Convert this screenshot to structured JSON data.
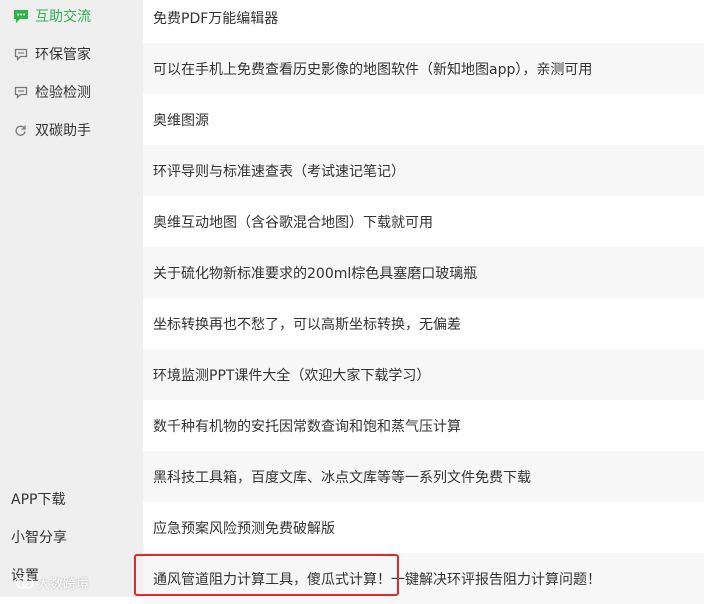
{
  "sidebar": {
    "items": [
      {
        "label": "互助交流",
        "icon": "chat-icon",
        "active": true
      },
      {
        "label": "环保管家",
        "icon": "chat-icon",
        "active": false
      },
      {
        "label": "检验检测",
        "icon": "chat-icon",
        "active": false
      },
      {
        "label": "双碳助手",
        "icon": "refresh-icon",
        "active": false
      }
    ],
    "bottom": [
      "APP下载",
      "小智分享",
      "设置"
    ],
    "watermark": "大数跨境"
  },
  "list": {
    "items": [
      "免费PDF万能编辑器",
      "可以在手机上免费查看历史影像的地图软件（新知地图app），亲测可用",
      "奥维图源",
      "环评导则与标准速查表（考试速记笔记）",
      "奥维互动地图（含谷歌混合地图）下载就可用",
      "关于硫化物新标准要求的200ml棕色具塞磨口玻璃瓶",
      "坐标转换再也不愁了，可以高斯坐标转换，无偏差",
      "环境监测PPT课件大全（欢迎大家下载学习）",
      "数千种有机物的安托因常数查询和饱和蒸气压计算",
      "黑科技工具箱，百度文库、冰点文库等等一系列文件免费下载",
      "应急预案风险预测免费破解版",
      "通风管道阻力计算工具，傻瓜式计算！一键解决环评报告阻力计算问题！"
    ]
  },
  "colors": {
    "active": "#2fb24c",
    "highlight": "#e5282a",
    "sidebar_bg": "#efefef",
    "alt_row": "#f7f7f7"
  }
}
